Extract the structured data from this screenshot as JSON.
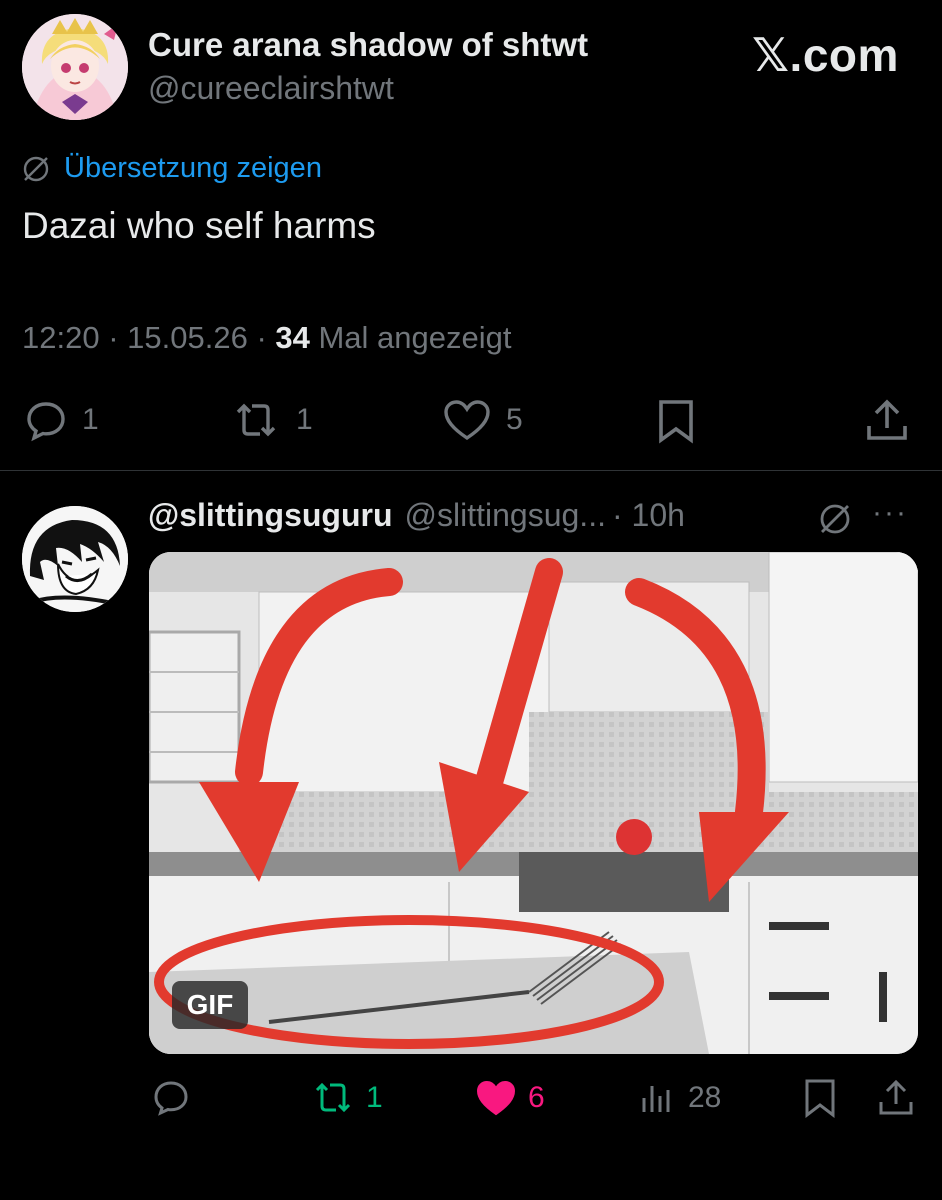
{
  "brand": {
    "logo_text": "𝕏.com"
  },
  "tweet": {
    "display_name": "Cure arana shadow of shtwt",
    "handle": "@cureeclairshtwt",
    "translate_label": "Übersetzung zeigen",
    "text": "Dazai who self harms",
    "time": "12:20",
    "date": "15.05.26",
    "views_count": "34",
    "views_label": "Mal angezeigt",
    "actions": {
      "replies": "1",
      "reposts": "1",
      "likes": "5"
    }
  },
  "reply": {
    "display_name": "@slittingsuguru",
    "handle": "@slittingsug...",
    "time": "· 10h",
    "more_label": "···",
    "media_badge": "GIF",
    "actions": {
      "reposts": "1",
      "likes": "6",
      "views": "28"
    }
  },
  "colors": {
    "background": "#000000",
    "text_primary": "#e7e9ea",
    "text_secondary": "#71767b",
    "link": "#1d9bf0",
    "repost_active": "#00ba7c",
    "like_active": "#f91880",
    "arrow_red": "#e23a2e"
  },
  "icons": [
    "globe-slash-icon",
    "reply-icon",
    "repost-icon",
    "like-icon",
    "bookmark-icon",
    "share-icon",
    "views-icon",
    "more-icon"
  ]
}
